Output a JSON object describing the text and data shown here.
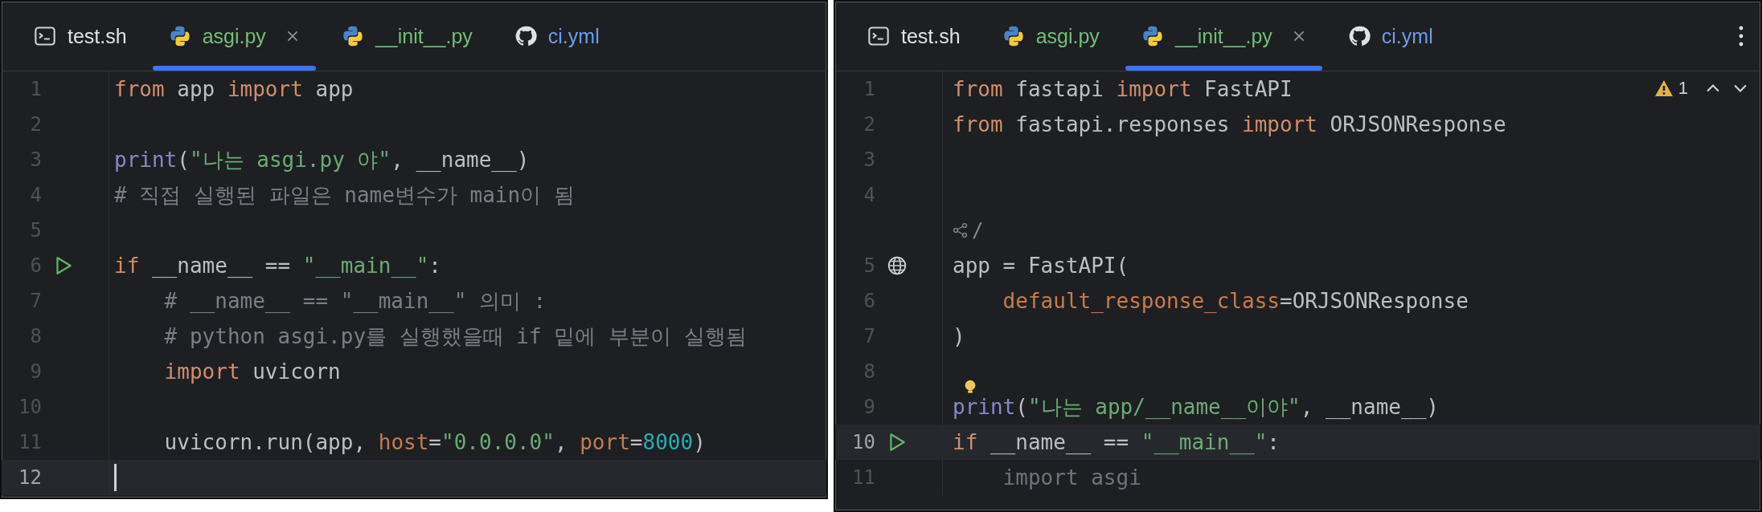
{
  "panes": [
    {
      "tabs": [
        {
          "label": "test.sh",
          "kind": "terminal",
          "color": "#dfe1e5",
          "selected": false
        },
        {
          "label": "asgi.py",
          "kind": "python",
          "color": "#73bd79",
          "selected": true
        },
        {
          "label": "__init__.py",
          "kind": "python",
          "color": "#73bd79",
          "selected": false
        },
        {
          "label": "ci.yml",
          "kind": "github",
          "color": "#6d9de8",
          "selected": false
        }
      ],
      "more_menu": false,
      "lines": [
        {
          "kind": "code",
          "number": "1",
          "current": false,
          "tokens": [
            {
              "kind": "kw",
              "text": "from"
            },
            {
              "kind": "plain",
              "text": " app "
            },
            {
              "kind": "kw",
              "text": "import"
            },
            {
              "kind": "plain",
              "text": " app"
            }
          ]
        },
        {
          "kind": "code",
          "number": "2",
          "current": false
        },
        {
          "kind": "code",
          "number": "3",
          "current": false,
          "tokens": [
            {
              "kind": "builtin",
              "text": "print"
            },
            {
              "kind": "plain",
              "text": "("
            },
            {
              "kind": "str",
              "text": "\"나는 asgi.py 야\""
            },
            {
              "kind": "plain",
              "text": ", __name__)"
            }
          ]
        },
        {
          "kind": "code",
          "number": "4",
          "current": false,
          "tokens": [
            {
              "kind": "comment",
              "text": "# 직접 실행된 파일은 name변수가 main이 됨"
            }
          ]
        },
        {
          "kind": "code",
          "number": "5",
          "current": false
        },
        {
          "kind": "code",
          "number": "6",
          "current": false,
          "gutter_mark": {
            "kind": "run"
          },
          "tokens": [
            {
              "kind": "kw",
              "text": "if"
            },
            {
              "kind": "plain",
              "text": " __name__ == "
            },
            {
              "kind": "str",
              "text": "\"__main__\""
            },
            {
              "kind": "plain",
              "text": ":"
            }
          ]
        },
        {
          "kind": "code",
          "number": "7",
          "current": false,
          "tokens": [
            {
              "kind": "comment",
              "text": "    # __name__ == \"__main__\" 의미 :"
            }
          ]
        },
        {
          "kind": "code",
          "number": "8",
          "current": false,
          "tokens": [
            {
              "kind": "comment",
              "text": "    # python asgi.py를 실행했을때 if 밑에 부분이 실행됨"
            }
          ]
        },
        {
          "kind": "code",
          "number": "9",
          "current": false,
          "tokens": [
            {
              "kind": "kw",
              "text": "    import"
            },
            {
              "kind": "plain",
              "text": " uvicorn"
            }
          ]
        },
        {
          "kind": "code",
          "number": "10",
          "current": false
        },
        {
          "kind": "code",
          "number": "11",
          "current": false,
          "tokens": [
            {
              "kind": "plain",
              "text": "    uvicorn.run(app, "
            },
            {
              "kind": "param",
              "text": "host"
            },
            {
              "kind": "plain",
              "text": "="
            },
            {
              "kind": "str",
              "text": "\"0.0.0.0\""
            },
            {
              "kind": "plain",
              "text": ", "
            },
            {
              "kind": "param",
              "text": "port"
            },
            {
              "kind": "plain",
              "text": "="
            },
            {
              "kind": "num",
              "text": "8000"
            },
            {
              "kind": "plain",
              "text": ")"
            }
          ]
        },
        {
          "kind": "code",
          "number": "12",
          "current": true,
          "caret": true
        }
      ]
    },
    {
      "tabs": [
        {
          "label": "test.sh",
          "kind": "terminal",
          "color": "#dfe1e5",
          "selected": false
        },
        {
          "label": "asgi.py",
          "kind": "python",
          "color": "#73bd79",
          "selected": false
        },
        {
          "label": "__init__.py",
          "kind": "python",
          "color": "#73bd79",
          "selected": true
        },
        {
          "label": "ci.yml",
          "kind": "github",
          "color": "#6d9de8",
          "selected": false
        }
      ],
      "more_menu": true,
      "inspection": {
        "warnings": "1"
      },
      "lines": [
        {
          "kind": "code",
          "number": "1",
          "current": false,
          "tokens": [
            {
              "kind": "kw",
              "text": "from"
            },
            {
              "kind": "plain",
              "text": " fastapi "
            },
            {
              "kind": "kw",
              "text": "import"
            },
            {
              "kind": "plain",
              "text": " FastAPI"
            }
          ]
        },
        {
          "kind": "code",
          "number": "2",
          "current": false,
          "tokens": [
            {
              "kind": "kw",
              "text": "from"
            },
            {
              "kind": "plain",
              "text": " fastapi.responses "
            },
            {
              "kind": "kw",
              "text": "import"
            },
            {
              "kind": "plain",
              "text": " ORJSONResponse"
            }
          ]
        },
        {
          "kind": "code",
          "number": "3",
          "current": false
        },
        {
          "kind": "code",
          "number": "4",
          "current": false
        },
        {
          "kind": "inlay",
          "text": "/"
        },
        {
          "kind": "code",
          "number": "5",
          "current": false,
          "gutter_mark": {
            "kind": "globe"
          },
          "tokens": [
            {
              "kind": "plain",
              "text": "app = FastAPI("
            }
          ]
        },
        {
          "kind": "code",
          "number": "6",
          "current": false,
          "tokens": [
            {
              "kind": "param",
              "text": "    default_response_class"
            },
            {
              "kind": "plain",
              "text": "=ORJSONResponse"
            }
          ]
        },
        {
          "kind": "code",
          "number": "7",
          "current": false,
          "tokens": [
            {
              "kind": "plain",
              "text": ")"
            }
          ]
        },
        {
          "kind": "code",
          "number": "8",
          "current": false
        },
        {
          "kind": "code",
          "number": "9",
          "current": false,
          "lightbulb": true,
          "tokens": [
            {
              "kind": "builtin",
              "text": "print"
            },
            {
              "kind": "plain",
              "text": "("
            },
            {
              "kind": "str",
              "text": "\"나는 app/__name__이야\""
            },
            {
              "kind": "plain",
              "text": ", __name__)"
            }
          ]
        },
        {
          "kind": "code",
          "number": "10",
          "current": true,
          "gutter_mark": {
            "kind": "run"
          },
          "tokens": [
            {
              "kind": "kw",
              "text": "if"
            },
            {
              "kind": "plain",
              "text": " __name__ == "
            },
            {
              "kind": "str",
              "text": "\"__main__\""
            },
            {
              "kind": "plain",
              "text": ":"
            }
          ]
        },
        {
          "kind": "code",
          "number": "11",
          "current": false,
          "tokens": [
            {
              "kind": "unused",
              "text": "    import asgi"
            }
          ]
        }
      ]
    }
  ]
}
